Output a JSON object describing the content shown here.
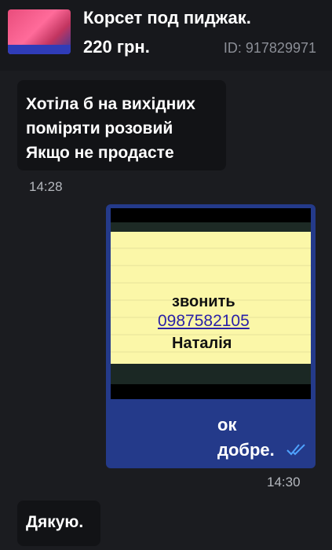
{
  "listing": {
    "title": "Корсет под пиджак.",
    "price": "220 грн.",
    "id_text": "ID: 917829971"
  },
  "messages": {
    "incoming_1": {
      "lines": [
        "Хотіла б на вихідних",
        "поміряти розовий",
        "Якщо не продасте"
      ],
      "time": "14:28"
    },
    "outgoing_1": {
      "photo_note": [
        "звонить",
        "0987582105",
        "Наталія"
      ],
      "lines": [
        "ок",
        "добре."
      ],
      "time": "14:30",
      "status": "double-check-read-icon"
    },
    "incoming_2": {
      "text": "Дякую."
    }
  },
  "colors": {
    "background": "#1b1c20",
    "incoming_bubble": "#121316",
    "outgoing_bubble": "#243a8a",
    "read_check": "#4fa3ff"
  }
}
